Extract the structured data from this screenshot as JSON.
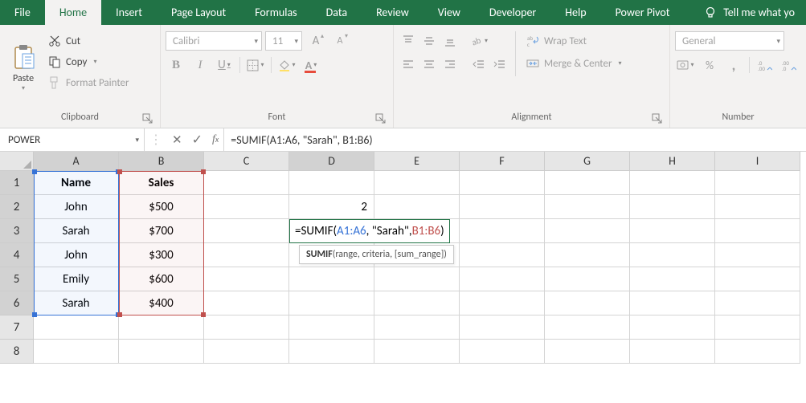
{
  "tabs": {
    "file": "File",
    "home": "Home",
    "insert": "Insert",
    "page_layout": "Page Layout",
    "formulas": "Formulas",
    "data": "Data",
    "review": "Review",
    "view": "View",
    "developer": "Developer",
    "help": "Help",
    "power_pivot": "Power Pivot",
    "tell_me": "Tell me what yo"
  },
  "clipboard": {
    "paste": "Paste",
    "cut": "Cut",
    "copy": "Copy",
    "format_painter": "Format Painter",
    "group": "Clipboard"
  },
  "font": {
    "name": "Calibri",
    "size": "11",
    "group": "Font",
    "bold": "B",
    "italic": "I",
    "underline": "U",
    "increase": "A",
    "decrease": "A"
  },
  "alignment": {
    "group": "Alignment",
    "wrap": "Wrap Text",
    "merge": "Merge & Center"
  },
  "number": {
    "group": "Number",
    "format": "General",
    "percent": "%",
    "comma": ","
  },
  "namebox": "POWER",
  "formula_bar": "=SUMIF(A1:A6, \"Sarah\", B1:B6)",
  "columns": [
    "A",
    "B",
    "C",
    "D",
    "E",
    "F",
    "G",
    "H",
    "I"
  ],
  "rows": [
    "1",
    "2",
    "3",
    "4",
    "5",
    "6",
    "7",
    "8"
  ],
  "table": {
    "header": {
      "name": "Name",
      "sales": "Sales"
    },
    "data": [
      {
        "name": "John",
        "sales": "$500"
      },
      {
        "name": "Sarah",
        "sales": "$700"
      },
      {
        "name": "John",
        "sales": "$300"
      },
      {
        "name": "Emily",
        "sales": "$600"
      },
      {
        "name": "Sarah",
        "sales": "$400"
      }
    ]
  },
  "d2": "2",
  "edit": {
    "pre": "=SUMIF(",
    "r1": "A1:A6",
    "mid": ", \"Sarah\", ",
    "r2": "B1:B6",
    "post": ")"
  },
  "tooltip": {
    "fn": "SUMIF",
    "sig": "(range, criteria, [sum_range])"
  }
}
